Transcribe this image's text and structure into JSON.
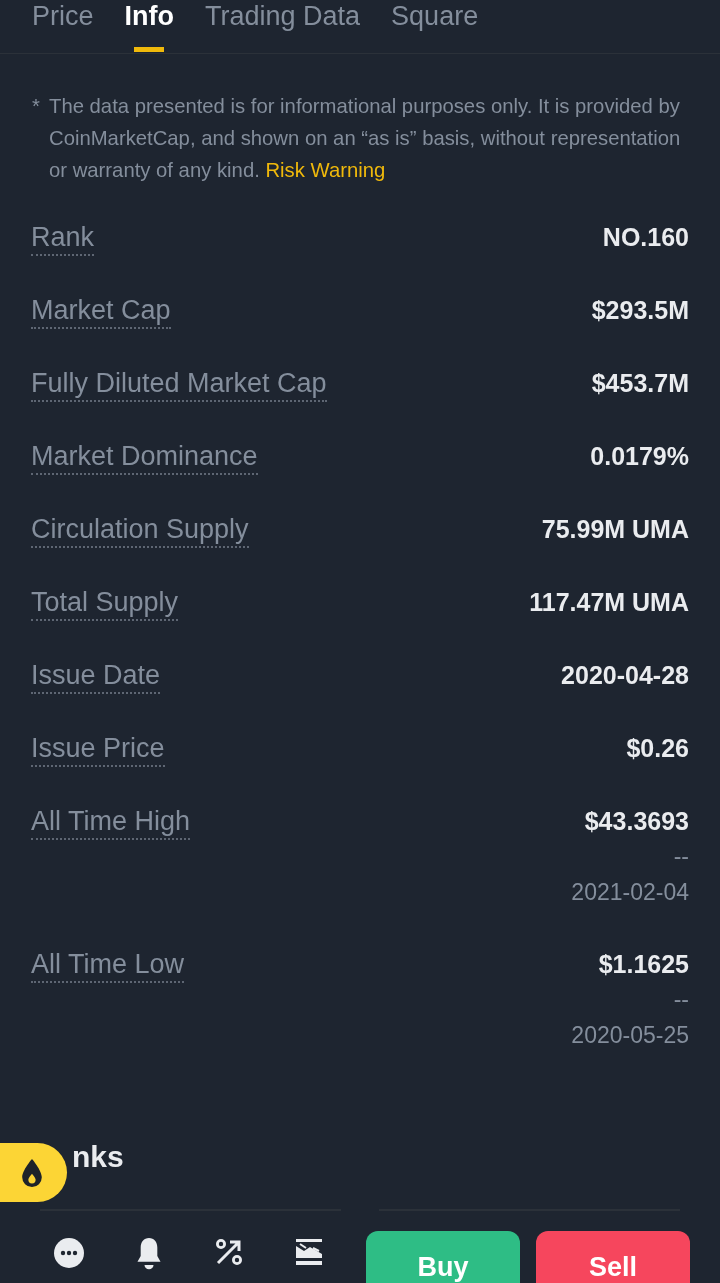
{
  "tabs": [
    {
      "label": "Price",
      "selected": false
    },
    {
      "label": "Info",
      "selected": true
    },
    {
      "label": "Trading Data",
      "selected": false
    },
    {
      "label": "Square",
      "selected": false
    }
  ],
  "disclaimer": {
    "marker": "*",
    "text": "The data presented is for informational purposes only. It is provided by CoinMarketCap, and shown on an “as is” basis, without representation or warranty of any kind.",
    "link": "Risk Warning"
  },
  "rows": [
    {
      "label": "Rank",
      "value": "NO.160"
    },
    {
      "label": "Market Cap",
      "value": "$293.5M"
    },
    {
      "label": "Fully Diluted Market Cap",
      "value": "$453.7M"
    },
    {
      "label": "Market Dominance",
      "value": "0.0179%"
    },
    {
      "label": "Circulation Supply",
      "value": "75.99M UMA"
    },
    {
      "label": "Total Supply",
      "value": "117.47M UMA"
    },
    {
      "label": "Issue Date",
      "value": "2020-04-28"
    },
    {
      "label": "Issue Price",
      "value": "$0.26"
    },
    {
      "label": "All Time High",
      "value": "$43.3693",
      "change": "--",
      "date": "2021-02-04"
    },
    {
      "label": "All Time Low",
      "value": "$1.1625",
      "change": "--",
      "date": "2020-05-25"
    }
  ],
  "links_heading": "nks",
  "actions": [
    {
      "label": "Buy",
      "kind": "buy"
    },
    {
      "label": "Sell",
      "kind": "sell"
    }
  ]
}
